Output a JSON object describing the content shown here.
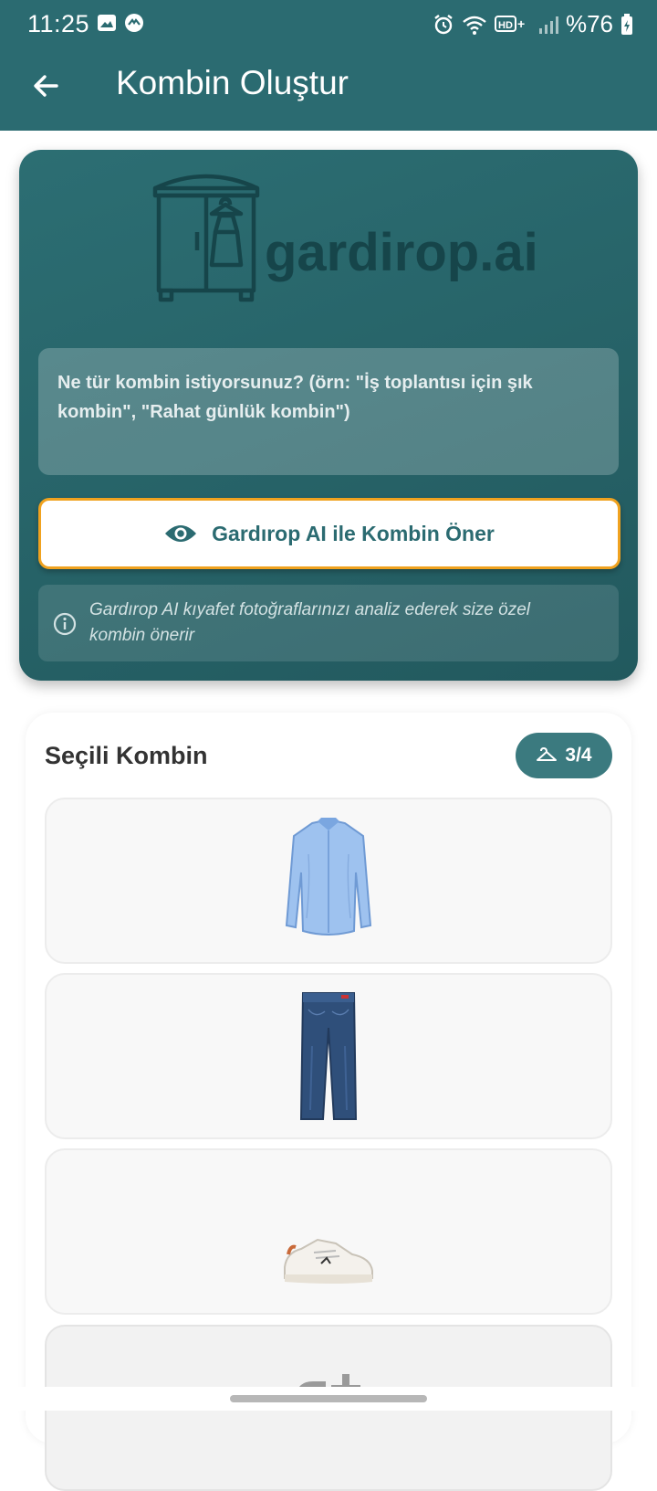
{
  "status": {
    "time": "11:25",
    "battery": "%76",
    "icons_left": [
      "image-icon",
      "messenger-icon"
    ],
    "icons_right": [
      "alarm-icon",
      "wifi-icon",
      "hd-icon",
      "signal-icon",
      "battery-icon"
    ]
  },
  "appbar": {
    "title": "Kombin Oluştur",
    "back_icon": "arrow-back-icon"
  },
  "colors": {
    "primary": "#2b6b71",
    "accent": "#f0a21f",
    "badge": "#3b7a7f"
  },
  "hero": {
    "logo_text": "gardirop.ai",
    "prompt_placeholder": "Ne tür kombin istiyorsunuz? (örn: \"İş toplantısı için şık kombin\", \"Rahat günlük kombin\")",
    "suggest_button": "Gardırop AI ile Kombin Öner",
    "info_text": "Gardırop AI kıyafet fotoğraflarınızı analiz ederek size özel kombin önerir"
  },
  "selected": {
    "title": "Seçili Kombin",
    "count": "3/4",
    "items": [
      {
        "name": "blue-shirt",
        "icon": "shirt-icon"
      },
      {
        "name": "denim-jeans",
        "icon": "jeans-icon"
      },
      {
        "name": "white-sneakers",
        "icon": "sneaker-icon"
      }
    ]
  }
}
